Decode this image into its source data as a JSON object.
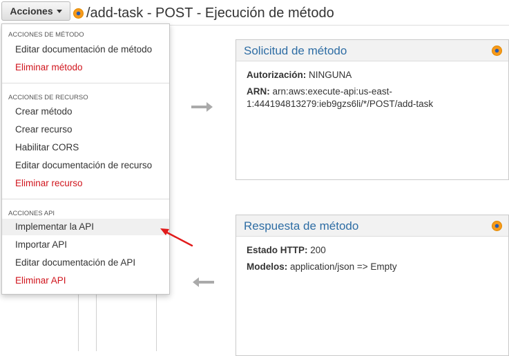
{
  "header": {
    "actions_button_label": "Acciones",
    "page_title": "/add-task - POST - Ejecución de método"
  },
  "dropdown": {
    "method_section": {
      "title": "ACCIONES DE MÉTODO",
      "items": [
        {
          "label": "Editar documentación de método",
          "danger": false
        },
        {
          "label": "Eliminar método",
          "danger": true
        }
      ]
    },
    "resource_section": {
      "title": "ACCIONES DE RECURSO",
      "items": [
        {
          "label": "Crear método",
          "danger": false
        },
        {
          "label": "Crear recurso",
          "danger": false
        },
        {
          "label": "Habilitar CORS",
          "danger": false
        },
        {
          "label": "Editar documentación de recurso",
          "danger": false
        },
        {
          "label": "Eliminar recurso",
          "danger": true
        }
      ]
    },
    "api_section": {
      "title": "ACCIONES API",
      "items": [
        {
          "label": "Implementar la API",
          "danger": false,
          "highlighted": true
        },
        {
          "label": "Importar API",
          "danger": false
        },
        {
          "label": "Editar documentación de API",
          "danger": false
        },
        {
          "label": "Eliminar API",
          "danger": true
        }
      ]
    }
  },
  "method_request": {
    "title": "Solicitud de método",
    "authorization_label": "Autorización:",
    "authorization_value": "NINGUNA",
    "arn_label": "ARN:",
    "arn_value": "arn:aws:execute-api:us-east-1:444194813279:ieb9gzs6li/*/POST/add-task"
  },
  "method_response": {
    "title": "Respuesta de método",
    "http_status_label": "Estado HTTP:",
    "http_status_value": "200",
    "models_label": "Modelos:",
    "models_value": "application/json => Empty"
  },
  "colors": {
    "accent_blue": "#2e6da4",
    "danger_red": "#d0141c",
    "status_orange": "#f79a1b",
    "annotation_red": "#e11b1b"
  },
  "icons": [
    "caret-down-icon",
    "status-dot-icon",
    "arrow-right-icon",
    "arrow-left-icon",
    "annotation-arrow-icon"
  ]
}
